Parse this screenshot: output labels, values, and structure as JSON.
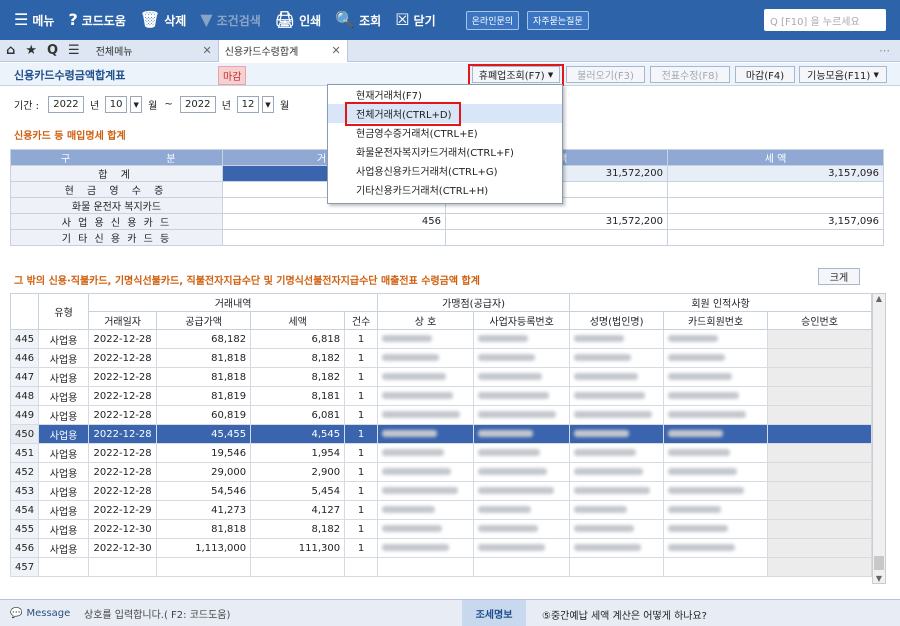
{
  "toolbar": {
    "menu": "메뉴",
    "code": "코드도움",
    "delete": "삭제",
    "cond": "조건검색",
    "print": "인쇄",
    "query": "조회",
    "close": "닫기",
    "online": "온라인문의",
    "faq": "자주묻는질문",
    "search_placeholder": "Q [F10] 을 누르세요"
  },
  "tabs": {
    "all_menu": "전체메뉴",
    "active": "신용카드수령합계"
  },
  "page": {
    "title": "신용카드수령금액합계표",
    "magam": "마감"
  },
  "buttons": {
    "closed_query": "휴폐업조회(F7)",
    "load": "불러오기(F3)",
    "edit": "전표수정(F8)",
    "deadline": "마감(F4)",
    "functions": "기능모음(F11)",
    "big": "크게"
  },
  "period": {
    "label": "기간 :",
    "from_year": "2022",
    "year_unit": "년",
    "from_month": "10",
    "month_unit": "월",
    "tilde": "~",
    "to_year": "2022",
    "to_month": "12"
  },
  "section1": "신용카드 등 매입명세 합계",
  "summary": {
    "col_gu": "구",
    "col_bun": "분",
    "col_count": "거 래 처",
    "col_supply": "가 액",
    "col_tax": "세 액",
    "rows": [
      {
        "label": "합 계",
        "count": "",
        "supply": "31,572,200",
        "tax": "3,157,096"
      },
      {
        "label": "현 금 영 수 증",
        "count": "",
        "supply": "",
        "tax": ""
      },
      {
        "label": "화물 운전자 복지카드",
        "count": "",
        "supply": "",
        "tax": ""
      },
      {
        "label": "사 업 용 신 용 카 드",
        "count": "456",
        "supply": "31,572,200",
        "tax": "3,157,096"
      },
      {
        "label": "기 타 신 용 카 드 등",
        "count": "",
        "supply": "",
        "tax": ""
      }
    ]
  },
  "section2": "그 밖의 신용·직불카드, 기명식선불카드, 직불전자지급수단 및 기명식선불전자지급수단 매출전표 수령금액 합계",
  "detail": {
    "h_type": "유형",
    "h_trade": "거래내역",
    "h_merchant": "가맹점(공급자)",
    "h_member": "회원 인적사항",
    "h_date": "거래일자",
    "h_supply": "공급가액",
    "h_tax": "세액",
    "h_qty": "건수",
    "h_name": "상 호",
    "h_biz": "사업자등록번호",
    "h_owner": "성명(법인명)",
    "h_card": "카드회원번호",
    "h_approval": "승인번호",
    "rows": [
      {
        "no": "445",
        "type": "사업용",
        "date": "2022-12-28",
        "supply": "68,182",
        "tax": "6,818",
        "qty": "1"
      },
      {
        "no": "446",
        "type": "사업용",
        "date": "2022-12-28",
        "supply": "81,818",
        "tax": "8,182",
        "qty": "1"
      },
      {
        "no": "447",
        "type": "사업용",
        "date": "2022-12-28",
        "supply": "81,818",
        "tax": "8,182",
        "qty": "1"
      },
      {
        "no": "448",
        "type": "사업용",
        "date": "2022-12-28",
        "supply": "81,819",
        "tax": "8,181",
        "qty": "1"
      },
      {
        "no": "449",
        "type": "사업용",
        "date": "2022-12-28",
        "supply": "60,819",
        "tax": "6,081",
        "qty": "1"
      },
      {
        "no": "450",
        "type": "사업용",
        "date": "2022-12-28",
        "supply": "45,455",
        "tax": "4,545",
        "qty": "1"
      },
      {
        "no": "451",
        "type": "사업용",
        "date": "2022-12-28",
        "supply": "19,546",
        "tax": "1,954",
        "qty": "1"
      },
      {
        "no": "452",
        "type": "사업용",
        "date": "2022-12-28",
        "supply": "29,000",
        "tax": "2,900",
        "qty": "1"
      },
      {
        "no": "453",
        "type": "사업용",
        "date": "2022-12-28",
        "supply": "54,546",
        "tax": "5,454",
        "qty": "1"
      },
      {
        "no": "454",
        "type": "사업용",
        "date": "2022-12-29",
        "supply": "41,273",
        "tax": "4,127",
        "qty": "1"
      },
      {
        "no": "455",
        "type": "사업용",
        "date": "2022-12-30",
        "supply": "81,818",
        "tax": "8,182",
        "qty": "1"
      },
      {
        "no": "456",
        "type": "사업용",
        "date": "2022-12-30",
        "supply": "1,113,000",
        "tax": "111,300",
        "qty": "1"
      },
      {
        "no": "457",
        "type": "",
        "date": "",
        "supply": "",
        "tax": "",
        "qty": ""
      }
    ]
  },
  "dropdown": [
    "현재거래처(F7)",
    "전체거래처(CTRL+D)",
    "현금영수증거래처(CTRL+E)",
    "화물운전자복지카드거래처(CTRL+F)",
    "사업용신용카드거래처(CTRL+G)",
    "기타신용카드거래처(CTRL+H)"
  ],
  "message": {
    "label": "Message",
    "text": "상호를 입력합니다.( F2: 코드도움)",
    "detail_btn": "조세명보",
    "question": "⑤중간예납 세액 계산은 어떻게 하나요?"
  },
  "colors": {
    "toolbar": "#2d63a8",
    "header": "#8fa9d4",
    "selected": "#3a64ad",
    "highlight": "#e01818"
  }
}
